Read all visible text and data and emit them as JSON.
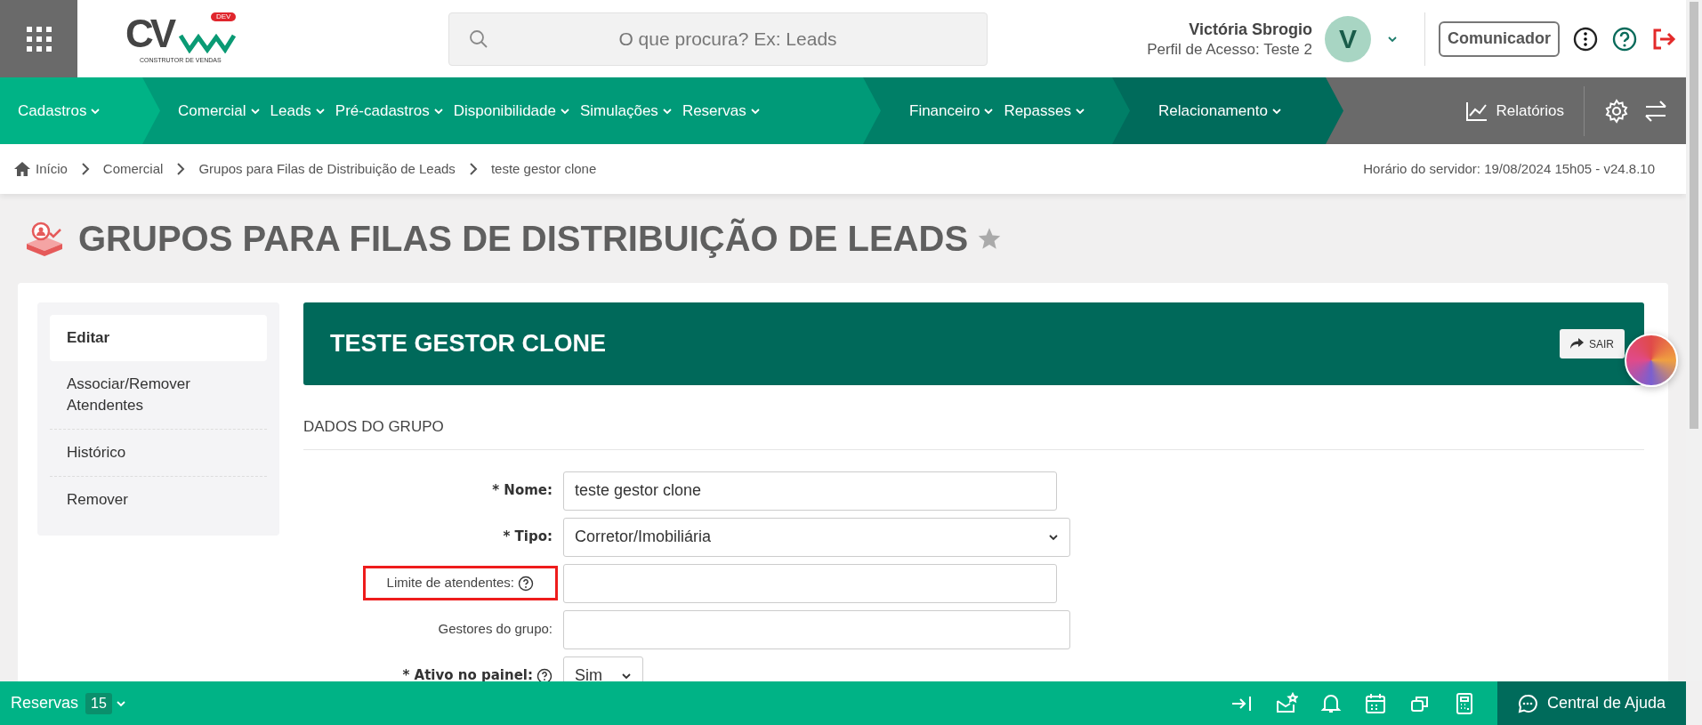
{
  "header": {
    "logo_text": "CV",
    "logo_badge": "DEV",
    "logo_subtitle": "CONSTRUTOR DE VENDAS",
    "search": {
      "placeholder": "O que procura? Ex: Leads"
    },
    "user": {
      "name": "Victória Sbrogio",
      "profile": "Perfil de Acesso: Teste 2",
      "initial": "V"
    },
    "communicator_button": "Comunicador"
  },
  "nav": [
    {
      "items": [
        "Cadastros"
      ]
    },
    {
      "items": [
        "Comercial",
        "Leads",
        "Pré-cadastros",
        "Disponibilidade",
        "Simulações",
        "Reservas"
      ]
    },
    {
      "items": [
        "Financeiro",
        "Repasses"
      ]
    },
    {
      "items": [
        "Relacionamento"
      ]
    }
  ],
  "nav_reports": "Relatórios",
  "breadcrumb": [
    "Início",
    "Comercial",
    "Grupos para Filas de Distribuição de Leads",
    "teste gestor clone"
  ],
  "server_time": "Horário do servidor: 19/08/2024 15h05 - v24.8.10",
  "page_title": "GRUPOS PARA FILAS DE DISTRIBUIÇÃO DE LEADS",
  "sidebar": {
    "items": [
      {
        "label": "Editar",
        "selected": true
      },
      {
        "label": "Associar/Remover Atendentes",
        "selected": false
      },
      {
        "label": "Histórico",
        "selected": false
      },
      {
        "label": "Remover",
        "selected": false
      }
    ]
  },
  "record_title": "TESTE GESTOR CLONE",
  "exit_button": "SAIR",
  "section_title": "DADOS DO GRUPO",
  "form": [
    {
      "label": "* Nome:",
      "kind": "text",
      "value": "teste gestor clone",
      "required": true
    },
    {
      "label": "* Tipo:",
      "kind": "select",
      "value": "Corretor/Imobiliária",
      "required": true
    },
    {
      "label": "Limite de atendentes:",
      "kind": "text",
      "required": false,
      "help": true,
      "highlighted": true
    },
    {
      "label": "Gestores do grupo:",
      "kind": "wide",
      "required": false
    },
    {
      "label": "* Ativo no painel:",
      "kind": "smallselect",
      "value": "Sim",
      "required": true,
      "help": true
    }
  ],
  "bottom_bar": {
    "reservations_label": "Reservas",
    "reservations_count": "15",
    "help_button": "Central de Ajuda"
  }
}
